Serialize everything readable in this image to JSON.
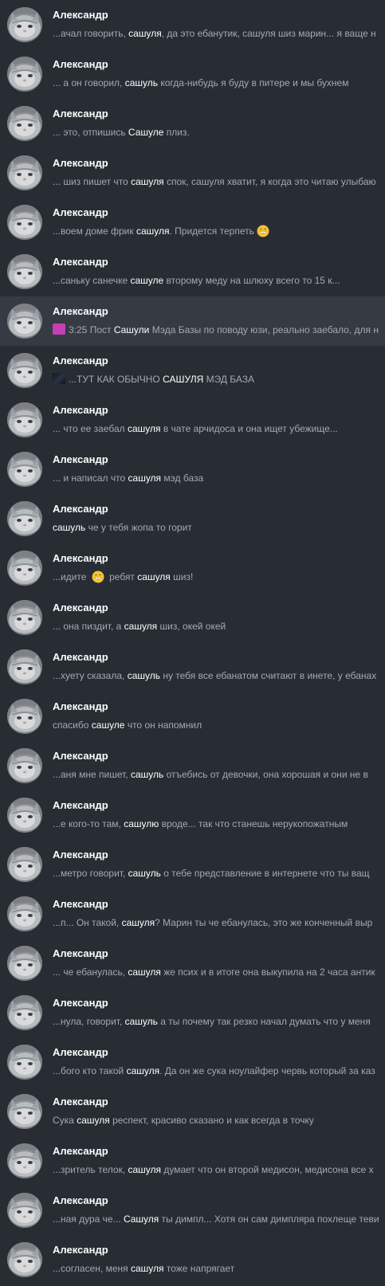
{
  "colors": {
    "background": "#282c33",
    "active_row": "#363a42",
    "name": "#ffffff",
    "snippet": "#a5a9b0",
    "highlight": "#ffffff"
  },
  "results": [
    {
      "name": "Александр",
      "parts": [
        {
          "t": "...ачал говорить, "
        },
        {
          "t": "сашуля",
          "hl": true
        },
        {
          "t": ", да это ебанутик, сашуля шиз марин... я ваще н"
        }
      ]
    },
    {
      "name": "Александр",
      "parts": [
        {
          "t": "... а он говорил, "
        },
        {
          "t": "сашуль",
          "hl": true
        },
        {
          "t": " когда-нибудь я буду в питере и мы бухнем"
        }
      ]
    },
    {
      "name": "Александр",
      "parts": [
        {
          "t": "... это, отпишись "
        },
        {
          "t": "Сашуле",
          "hl": true
        },
        {
          "t": " плиз."
        }
      ]
    },
    {
      "name": "Александр",
      "parts": [
        {
          "t": "... шиз пишет что "
        },
        {
          "t": "сашуля",
          "hl": true
        },
        {
          "t": " спок, сашуля хватит, я когда это читаю улыбаю"
        }
      ]
    },
    {
      "name": "Александр",
      "parts": [
        {
          "t": "...воем доме фрик "
        },
        {
          "t": "сашуля",
          "hl": true
        },
        {
          "t": ". Придется терпеть"
        },
        {
          "emoji": "grin-emoji"
        }
      ]
    },
    {
      "name": "Александр",
      "parts": [
        {
          "t": "...саньку санечке "
        },
        {
          "t": "сашуле",
          "hl": true
        },
        {
          "t": " второму меду на шлюху всего то 15 к..."
        }
      ]
    },
    {
      "name": "Александр",
      "active": true,
      "thumb": "pink",
      "parts": [
        {
          "t": "3:25 Пост "
        },
        {
          "t": "Сашули",
          "hl": true
        },
        {
          "t": " Мэда Базы  по поводу юзи, реально заебало, для н"
        }
      ]
    },
    {
      "name": "Александр",
      "thumb": "dark",
      "parts": [
        {
          "t": "...ТУТ КАК ОБЫЧНО "
        },
        {
          "t": "САШУЛЯ",
          "hl": true
        },
        {
          "t": " МЭД БАЗА"
        }
      ]
    },
    {
      "name": "Александр",
      "parts": [
        {
          "t": "... что ее заебал "
        },
        {
          "t": "сашуля",
          "hl": true
        },
        {
          "t": " в чате арчидоса и она ищет убежище..."
        }
      ]
    },
    {
      "name": "Александр",
      "parts": [
        {
          "t": "... и написал что "
        },
        {
          "t": "сашуля",
          "hl": true
        },
        {
          "t": " мэд база"
        }
      ]
    },
    {
      "name": "Александр",
      "parts": [
        {
          "t": "сашуль",
          "hl": true
        },
        {
          "t": " че у тебя жопа то горит"
        }
      ]
    },
    {
      "name": "Александр",
      "parts": [
        {
          "t": "...идите "
        },
        {
          "emoji": "grin-emoji"
        },
        {
          "t": " ребят "
        },
        {
          "t": "сашуля",
          "hl": true
        },
        {
          "t": " шиз!"
        }
      ]
    },
    {
      "name": "Александр",
      "parts": [
        {
          "t": "... она пиздит, а "
        },
        {
          "t": "сашуля",
          "hl": true
        },
        {
          "t": " шиз, окей окей"
        }
      ]
    },
    {
      "name": "Александр",
      "parts": [
        {
          "t": "...хуету сказала, "
        },
        {
          "t": "сашуль",
          "hl": true
        },
        {
          "t": " ну тебя все ебанатом считают в инете, у ебанах"
        }
      ]
    },
    {
      "name": "Александр",
      "parts": [
        {
          "t": "спасибо "
        },
        {
          "t": "сашуле",
          "hl": true
        },
        {
          "t": " что он напомнил"
        }
      ]
    },
    {
      "name": "Александр",
      "parts": [
        {
          "t": "...аня мне пишет, "
        },
        {
          "t": "сашуль",
          "hl": true
        },
        {
          "t": " отъебись от девочки, она хорошая и они не в"
        }
      ]
    },
    {
      "name": "Александр",
      "parts": [
        {
          "t": "...е кого-то там, "
        },
        {
          "t": "сашулю",
          "hl": true
        },
        {
          "t": " вроде... так что станешь нерукопожатным"
        }
      ]
    },
    {
      "name": "Александр",
      "parts": [
        {
          "t": "...метро говорит, "
        },
        {
          "t": "сашуль",
          "hl": true
        },
        {
          "t": " о тебе представление в интернете что ты ващ"
        }
      ]
    },
    {
      "name": "Александр",
      "parts": [
        {
          "t": "...п... Он такой, "
        },
        {
          "t": "сашуля",
          "hl": true
        },
        {
          "t": "? Марин ты че ебанулась, это же конченный выр"
        }
      ]
    },
    {
      "name": "Александр",
      "parts": [
        {
          "t": "... че ебанулась, "
        },
        {
          "t": "сашуля",
          "hl": true
        },
        {
          "t": " же псих и в итоге она выкупила на 2 часа антик"
        }
      ]
    },
    {
      "name": "Александр",
      "parts": [
        {
          "t": "...нула, говорит, "
        },
        {
          "t": "сашуль",
          "hl": true
        },
        {
          "t": " а ты почему так резко начал думать что у меня"
        }
      ]
    },
    {
      "name": "Александр",
      "parts": [
        {
          "t": "...бого кто такой "
        },
        {
          "t": "сашуля",
          "hl": true
        },
        {
          "t": ". Да он же сука ноулайфер червь который за каз"
        }
      ]
    },
    {
      "name": "Александр",
      "parts": [
        {
          "t": "Сука "
        },
        {
          "t": "сашуля",
          "hl": true
        },
        {
          "t": " респект, красиво сказано и как всегда в точку"
        }
      ]
    },
    {
      "name": "Александр",
      "parts": [
        {
          "t": "...зритель телок, "
        },
        {
          "t": "сашуля",
          "hl": true
        },
        {
          "t": " думает что он второй медисон, медисона все х"
        }
      ]
    },
    {
      "name": "Александр",
      "parts": [
        {
          "t": "...ная дура че... "
        },
        {
          "t": "Сашуля",
          "hl": true
        },
        {
          "t": " ты димпл... Хотя он сам димпляра похлеще теви"
        }
      ]
    },
    {
      "name": "Александр",
      "parts": [
        {
          "t": "...согласен, меня "
        },
        {
          "t": "сашуля",
          "hl": true
        },
        {
          "t": " тоже напрягает"
        }
      ]
    }
  ]
}
